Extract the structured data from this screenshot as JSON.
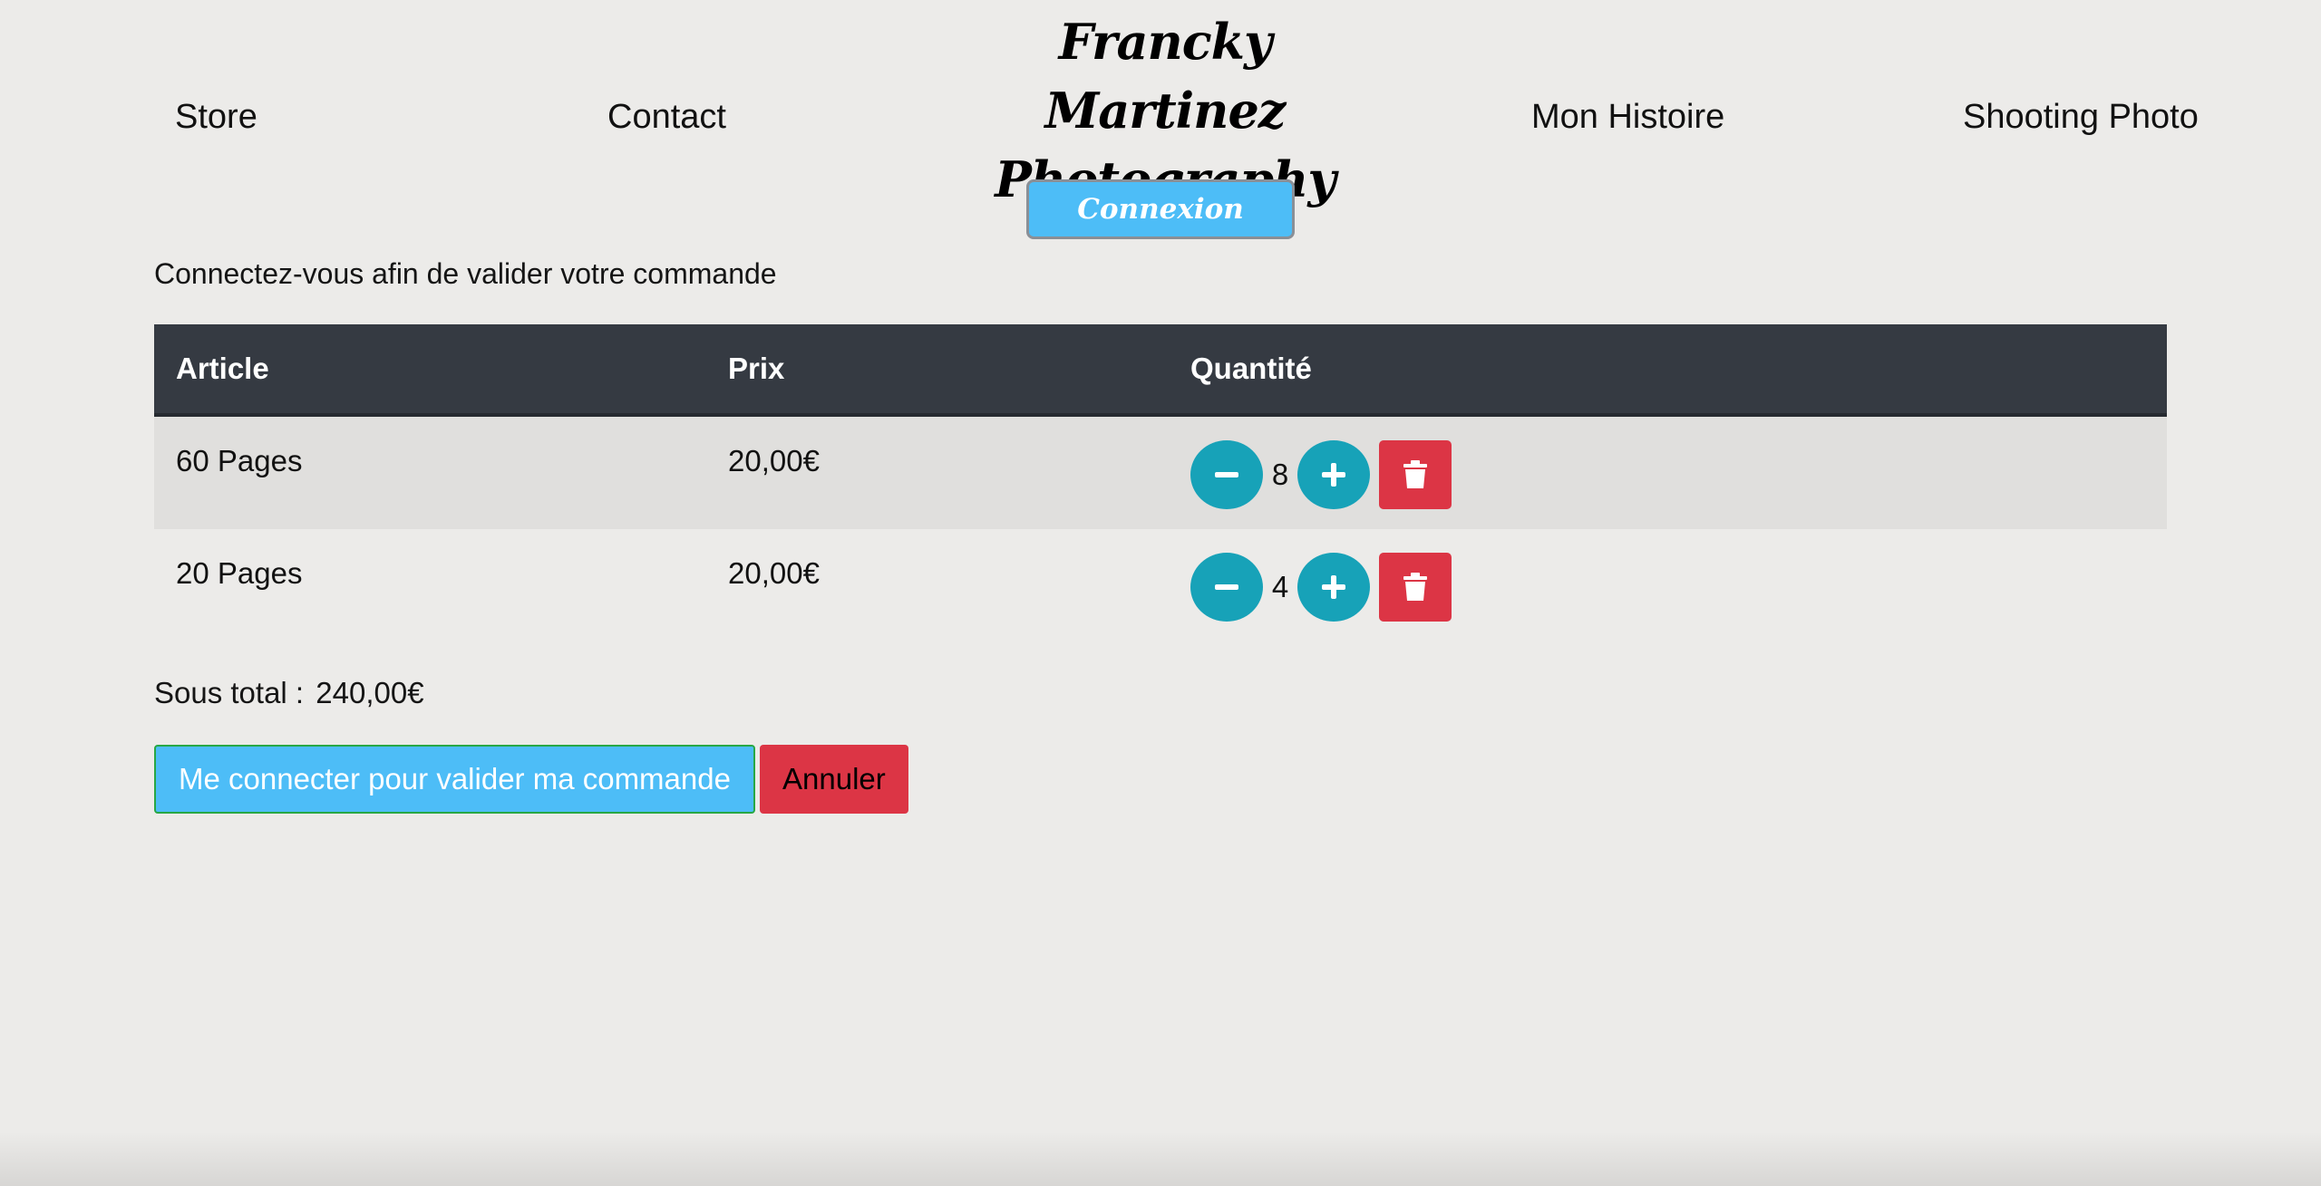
{
  "header": {
    "nav_left": [
      "Store",
      "Contact"
    ],
    "brand_line1": "Francky Martinez",
    "brand_line2": "Photography",
    "nav_right": [
      "Mon Histoire",
      "Shooting Photo"
    ],
    "login_label": "Connexion"
  },
  "cart": {
    "notice": "Connectez-vous afin de valider votre commande",
    "columns": [
      "Article",
      "Prix",
      "Quantité"
    ],
    "rows": [
      {
        "article": "60 Pages",
        "prix": "20,00€",
        "quantite": "8"
      },
      {
        "article": "20 Pages",
        "prix": "20,00€",
        "quantite": "4"
      }
    ],
    "subtotal_label": "Sous total :",
    "subtotal_value": "240,00€",
    "validate_label": "Me connecter pour valider ma commande",
    "cancel_label": "Annuler"
  },
  "icons": {
    "decrement": "minus-icon",
    "increment": "plus-icon",
    "delete": "trash-icon"
  },
  "colors": {
    "background": "#ecebe9",
    "table_header": "#353a42",
    "accent_blue": "#4dbdf7",
    "info_teal": "#17a2b8",
    "danger_red": "#dc3545"
  }
}
